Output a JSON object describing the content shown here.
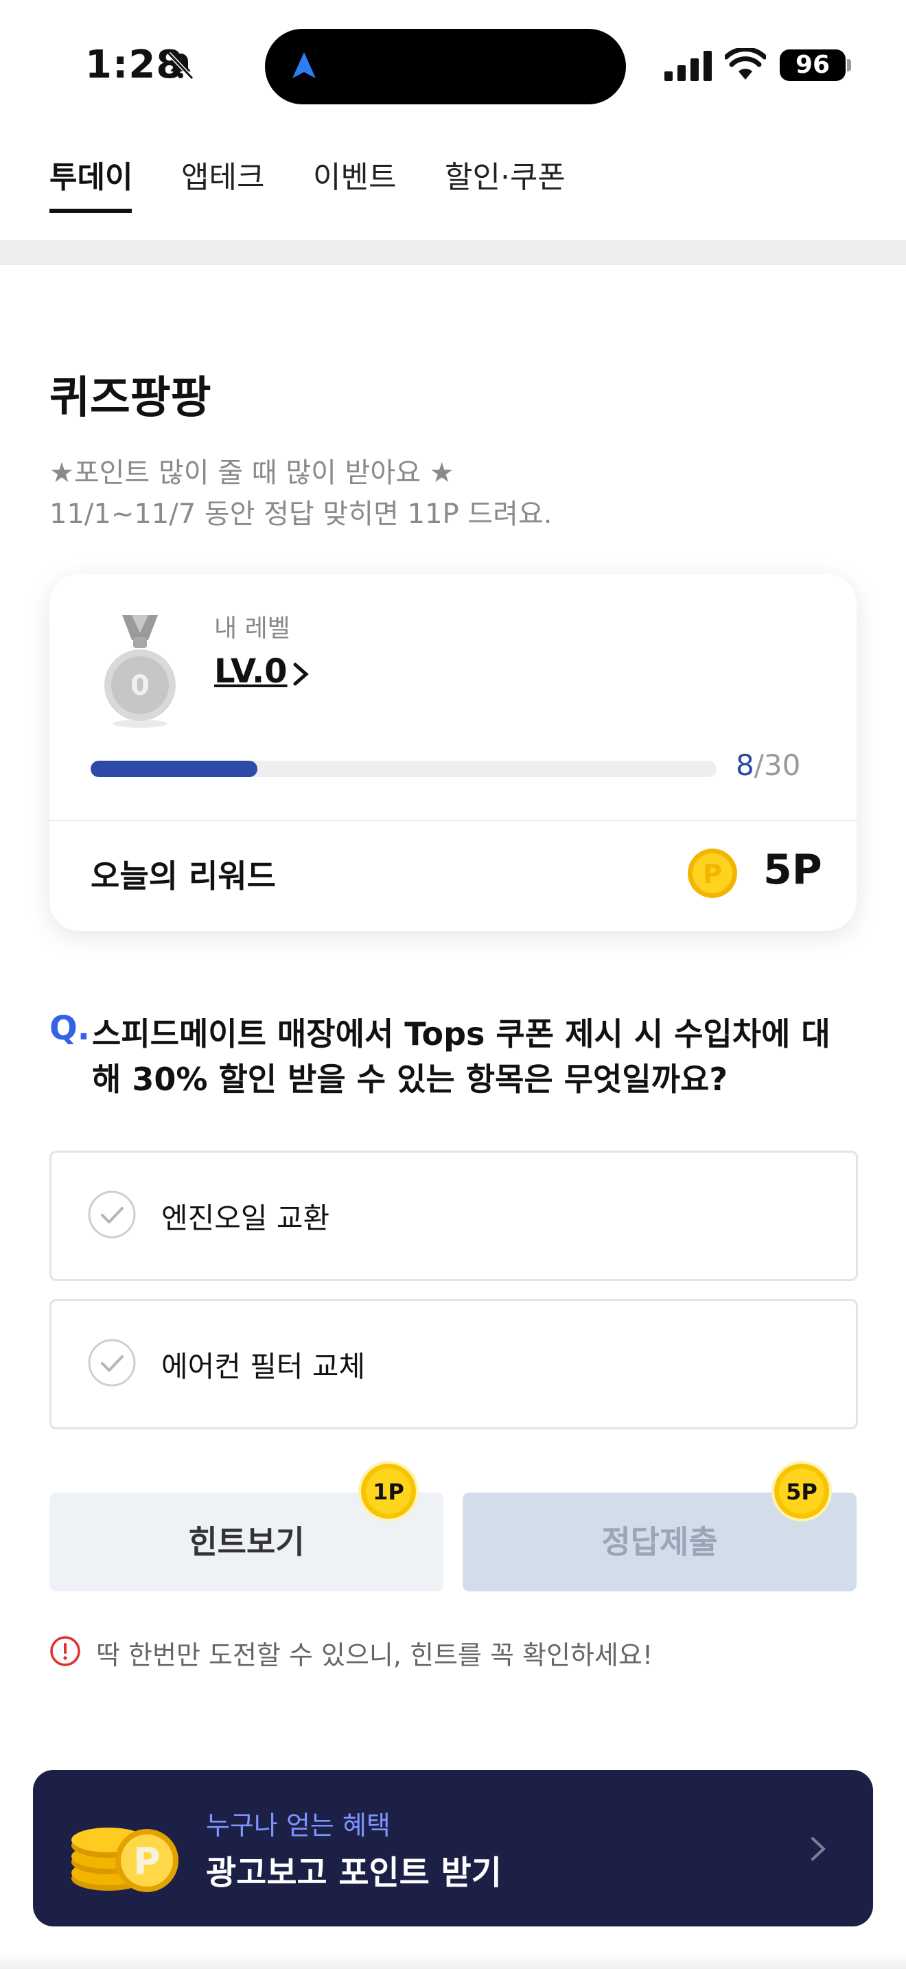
{
  "status_bar": {
    "time": "1:28",
    "battery": "96"
  },
  "tabs": [
    {
      "label": "투데이",
      "active": true
    },
    {
      "label": "앱테크",
      "active": false
    },
    {
      "label": "이벤트",
      "active": false
    },
    {
      "label": "할인·쿠폰",
      "active": false
    }
  ],
  "quiz": {
    "title": "퀴즈팡팡",
    "subtitle_line1": "★포인트 많이 줄 때 많이 받아요 ★",
    "subtitle_line2": "11/1~11/7 동안 정답 맞히면 11P 드려요."
  },
  "level_card": {
    "caption": "내 레벨",
    "level": "LV.0",
    "medal_number": "0",
    "progress_current": "8",
    "progress_total": "/30",
    "progress_fraction": 0.2667,
    "reward_label": "오늘의 리워드",
    "reward_value": "5P"
  },
  "question": {
    "mark": "Q.",
    "line1": "스피드메이트 매장에서 Tops 쿠폰 제시 시 수입차에 대",
    "line2": "해 30% 할인 받을 수 있는 항목은 무엇일까요?"
  },
  "options": [
    {
      "label": "엔진오일 교환"
    },
    {
      "label": "에어컨 필터 교체"
    }
  ],
  "actions": {
    "hint_label": "힌트보기",
    "hint_badge": "1P",
    "submit_label": "정답제출",
    "submit_badge": "5P"
  },
  "warning": "딱 한번만 도전할 수 있으니, 힌트를 꼭 확인하세요!",
  "banner": {
    "subtitle": "누구나 얻는 혜택",
    "title": "광고보고 포인트 받기"
  },
  "colors": {
    "accent_blue": "#3561e6",
    "progress_blue": "#2c4aa7",
    "banner_navy": "#1d2046",
    "coin_gold": "#f6c400"
  }
}
